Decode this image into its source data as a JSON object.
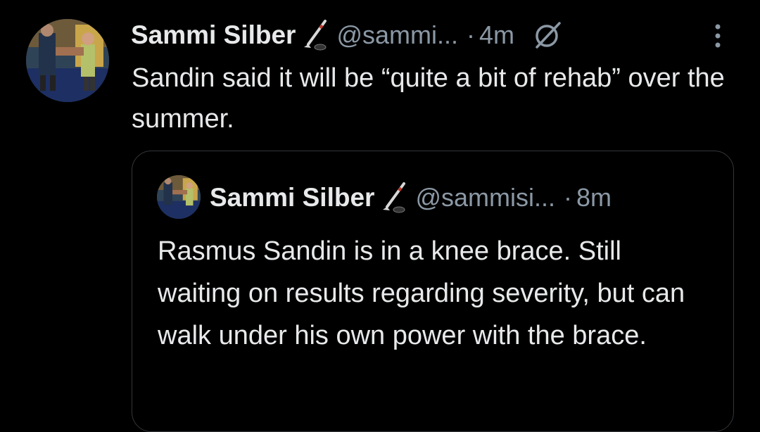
{
  "tweet": {
    "author_name": "Sammi Silber",
    "handle": "@sammi...",
    "separator": "·",
    "time": "4m",
    "text": "Sandin said it will be “quite a bit of rehab” over the summer."
  },
  "quoted_tweet": {
    "author_name": "Sammi Silber",
    "handle": "@sammisi...",
    "separator": "·",
    "time": "8m",
    "text": "Rasmus Sandin is in a knee brace. Still waiting on results regarding severity, but can walk under his own power with the brace."
  },
  "icons": {
    "name_emoji": "hockey-stick-icon",
    "edited": "edited-icon",
    "more": "more-vertical-icon"
  },
  "colors": {
    "background": "#000000",
    "primary_text": "#e7e9ea",
    "secondary_text": "#8b98a5",
    "border": "#333639"
  }
}
